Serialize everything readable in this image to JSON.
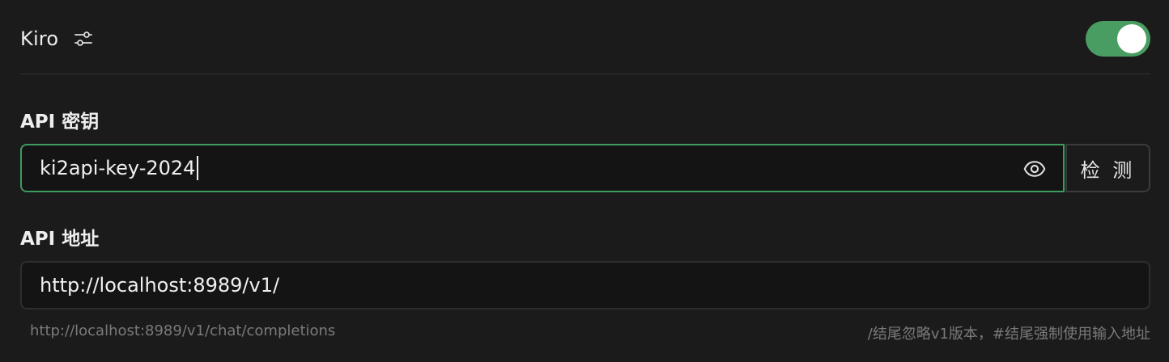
{
  "provider": {
    "name": "Kiro",
    "settings_icon": "sliders-icon",
    "enabled": true,
    "toggle_color": "#4a9d62"
  },
  "api_key": {
    "label": "API 密钥",
    "value": "ki2api-key-2024",
    "reveal_icon": "eye-icon",
    "check_button_label": "检 测",
    "focus_color": "#3f9a5d"
  },
  "api_url": {
    "label": "API 地址",
    "value": "http://localhost:8989/v1/",
    "resolved_hint": "http://localhost:8989/v1/chat/completions",
    "rule_hint": "/结尾忽略v1版本，#结尾强制使用输入地址"
  }
}
